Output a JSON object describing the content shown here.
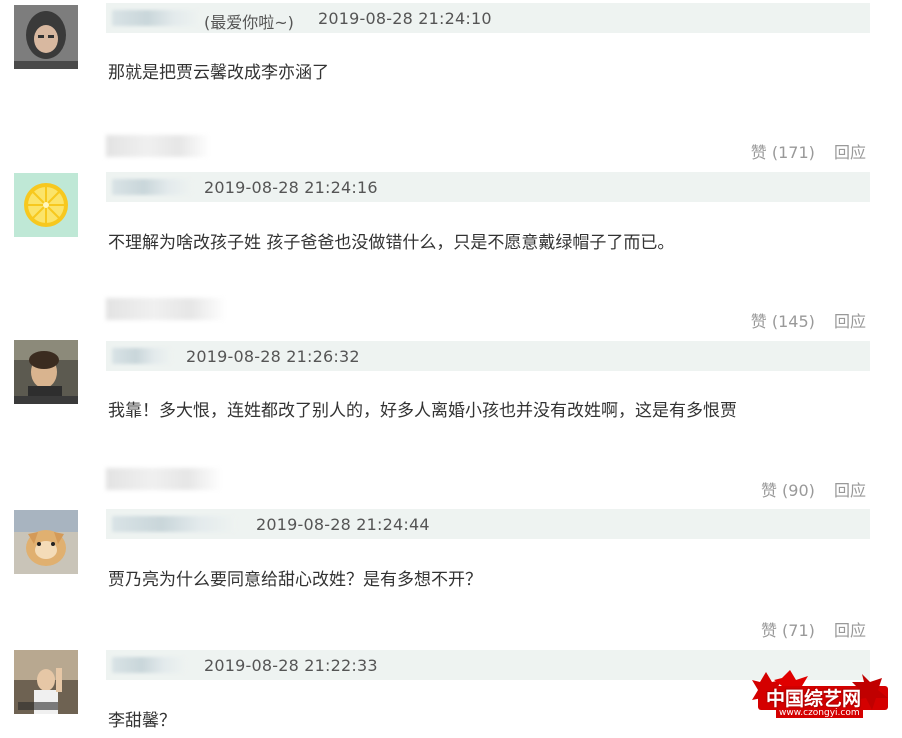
{
  "comments": [
    {
      "nick_suffix": "(最爱你啦~)",
      "timestamp": "2019-08-28 21:24:10",
      "text": "那就是把贾云馨改成李亦涵了",
      "likes": "赞 (171)",
      "reply": "回应",
      "avatar_color": "#6b6b6b"
    },
    {
      "nick_suffix": "",
      "timestamp": "2019-08-28 21:24:16",
      "text": "不理解为啥改孩子姓 孩子爸爸也没做错什么，只是不愿意戴绿帽子了而已。",
      "likes": "赞 (145)",
      "reply": "回应",
      "avatar_color": "#bfe8d6"
    },
    {
      "nick_suffix": "",
      "timestamp": "2019-08-28 21:26:32",
      "text": "我靠！多大恨，连姓都改了别人的，好多人离婚小孩也并没有改姓啊，这是有多恨贾",
      "likes": "赞 (90)",
      "reply": "回应",
      "avatar_color": "#7a7566"
    },
    {
      "nick_suffix": "",
      "timestamp": "2019-08-28 21:24:44",
      "text": "贾乃亮为什么要同意给甜心改姓？是有多想不开？",
      "likes": "赞 (71)",
      "reply": "回应",
      "avatar_color": "#a89a80"
    },
    {
      "nick_suffix": "",
      "timestamp": "2019-08-28 21:22:33",
      "text": "李甜馨？",
      "likes": "",
      "reply": "",
      "avatar_color": "#8a7a66"
    }
  ],
  "watermark": {
    "title": "中国综艺网",
    "url": "www.czongyi.com",
    "color": "#d40000"
  }
}
